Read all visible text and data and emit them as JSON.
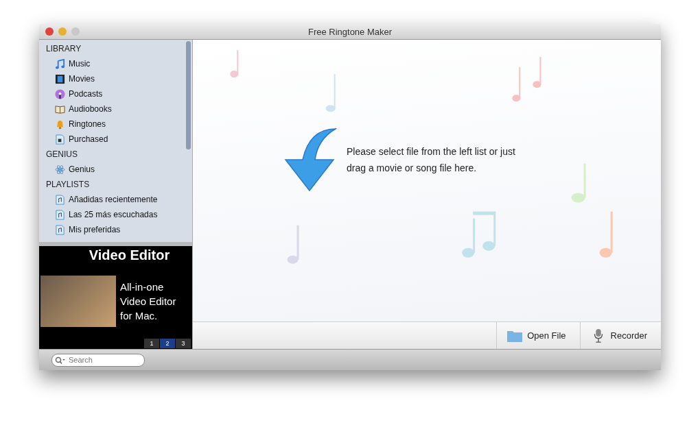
{
  "window": {
    "title": "Free Ringtone Maker"
  },
  "sidebar": {
    "sections": [
      {
        "heading": "LIBRARY",
        "items": [
          {
            "label": "Music",
            "kind": "music"
          },
          {
            "label": "Movies",
            "kind": "movies"
          },
          {
            "label": "Podcasts",
            "kind": "podcasts"
          },
          {
            "label": "Audiobooks",
            "kind": "audiobooks"
          },
          {
            "label": "Ringtones",
            "kind": "ringtones"
          },
          {
            "label": "Purchased",
            "kind": "purchased"
          }
        ]
      },
      {
        "heading": "GENIUS",
        "items": [
          {
            "label": "Genius",
            "kind": "genius"
          }
        ]
      },
      {
        "heading": "PLAYLISTS",
        "items": [
          {
            "label": "Añadidas recientemente",
            "kind": "playlist"
          },
          {
            "label": "Las 25 más escuchadas",
            "kind": "playlist"
          },
          {
            "label": "Mis preferidas",
            "kind": "playlist"
          }
        ]
      }
    ]
  },
  "ad": {
    "title": "Video Editor",
    "text": "All-in-one Video Editor for Mac.",
    "pages": [
      {
        "label": "1",
        "selected": false
      },
      {
        "label": "2",
        "selected": true
      },
      {
        "label": "3",
        "selected": false
      }
    ]
  },
  "main": {
    "message": "Please select file from the left list or just drag a movie or song file here."
  },
  "toolbar": [
    {
      "label": "Open File",
      "kind": "folder"
    },
    {
      "label": "Recorder",
      "kind": "mic"
    }
  ],
  "search": {
    "placeholder": "Search"
  }
}
